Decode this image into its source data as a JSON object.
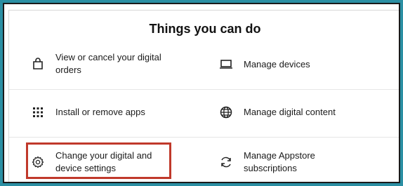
{
  "section": {
    "title": "Things you can do"
  },
  "items": [
    {
      "label": "View or cancel your digital orders",
      "icon": "shopping-bag-icon"
    },
    {
      "label": "Manage devices",
      "icon": "laptop-icon"
    },
    {
      "label": "Install or remove apps",
      "icon": "app-grid-icon"
    },
    {
      "label": "Manage digital content",
      "icon": "globe-icon"
    },
    {
      "label": "Change your digital and device settings",
      "icon": "gear-icon"
    },
    {
      "label": "Manage Appstore subscriptions",
      "icon": "refresh-icon"
    }
  ],
  "colors": {
    "frame": "#2b8fa3",
    "highlight": "#c0392b",
    "text": "#1a1a1a"
  }
}
